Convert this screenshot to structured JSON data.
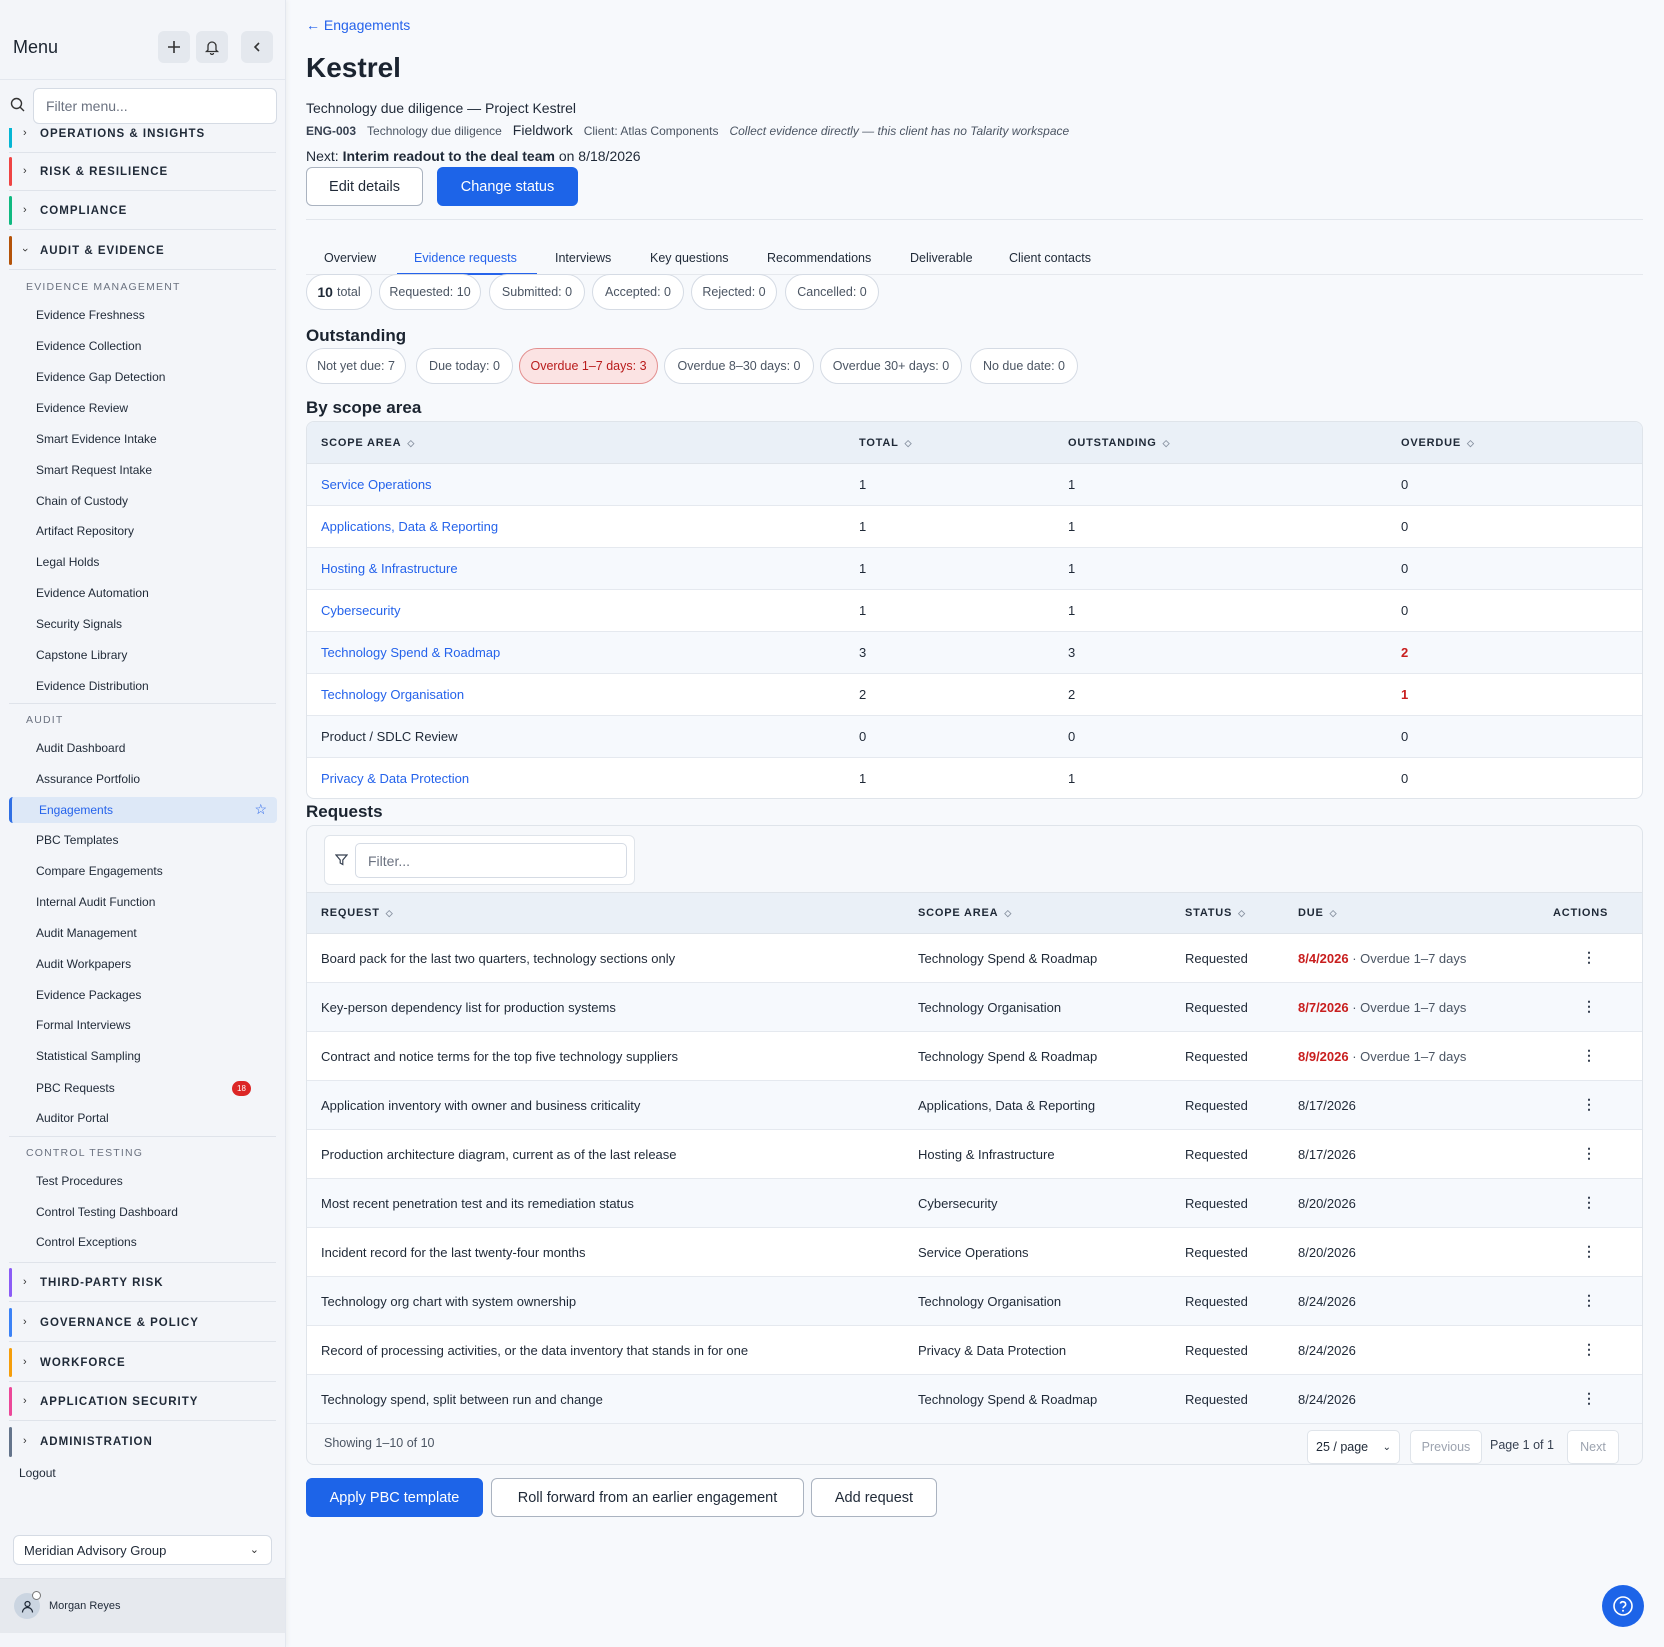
{
  "sidebar": {
    "title": "Menu",
    "filter_placeholder": "Filter menu...",
    "categories": [
      {
        "label": "OPERATIONS & INSIGHTS",
        "color": "#06b6d4"
      },
      {
        "label": "RISK & RESILIENCE",
        "color": "#ef4444"
      },
      {
        "label": "COMPLIANCE",
        "color": "#10b981"
      },
      {
        "label": "AUDIT & EVIDENCE",
        "color": "#b45309"
      },
      {
        "label": "THIRD-PARTY RISK",
        "color": "#8b5cf6"
      },
      {
        "label": "GOVERNANCE & POLICY",
        "color": "#3b82f6"
      },
      {
        "label": "WORKFORCE",
        "color": "#f59e0b"
      },
      {
        "label": "APPLICATION SECURITY",
        "color": "#ec4899"
      },
      {
        "label": "ADMINISTRATION",
        "color": "#64748b"
      }
    ],
    "sections": {
      "evidence": "EVIDENCE MANAGEMENT",
      "audit": "AUDIT",
      "control": "CONTROL TESTING"
    },
    "evidence_items": [
      "Evidence Freshness",
      "Evidence Collection",
      "Evidence Gap Detection",
      "Evidence Review",
      "Smart Evidence Intake",
      "Smart Request Intake",
      "Chain of Custody",
      "Artifact Repository",
      "Legal Holds",
      "Evidence Automation",
      "Security Signals",
      "Capstone Library",
      "Evidence Distribution"
    ],
    "audit_items": [
      "Audit Dashboard",
      "Assurance Portfolio",
      "Engagements",
      "PBC Templates",
      "Compare Engagements",
      "Internal Audit Function",
      "Audit Management",
      "Audit Workpapers",
      "Evidence Packages",
      "Formal Interviews",
      "Statistical Sampling",
      "PBC Requests",
      "Auditor Portal"
    ],
    "pbc_badge": "18",
    "control_items": [
      "Test Procedures",
      "Control Testing Dashboard",
      "Control Exceptions"
    ],
    "logout": "Logout",
    "org": "Meridian Advisory Group",
    "user": "Morgan Reyes"
  },
  "header": {
    "back": "← Engagements",
    "title": "Kestrel",
    "subtitle": "Technology due diligence — Project Kestrel",
    "code": "ENG-003",
    "type": "Technology due diligence",
    "phase": "Fieldwork",
    "client": "Client: Atlas Components",
    "note": "Collect evidence directly — this client has no Talarity workspace",
    "next_prefix": "Next: ",
    "next_item": "Interim readout to the deal team",
    "next_suffix": " on 8/18/2026",
    "edit": "Edit details",
    "change": "Change status"
  },
  "tabs": [
    "Overview",
    "Evidence requests",
    "Interviews",
    "Key questions",
    "Recommendations",
    "Deliverable",
    "Client contacts"
  ],
  "status_chips": {
    "total_num": "10",
    "total_word": "total",
    "items": [
      "Requested: 10",
      "Submitted: 0",
      "Accepted: 0",
      "Rejected: 0",
      "Cancelled: 0"
    ]
  },
  "outstanding": {
    "title": "Outstanding",
    "chips": [
      "Not yet due: 7",
      "Due today: 0",
      "Overdue 1–7 days: 3",
      "Overdue 8–30 days: 0",
      "Overdue 30+ days: 0",
      "No due date: 0"
    ]
  },
  "scope": {
    "title": "By scope area",
    "headers": [
      "SCOPE AREA",
      "TOTAL",
      "OUTSTANDING",
      "OVERDUE"
    ],
    "rows": [
      {
        "area": "Service Operations",
        "total": "1",
        "outstanding": "1",
        "overdue": "0"
      },
      {
        "area": "Applications, Data & Reporting",
        "total": "1",
        "outstanding": "1",
        "overdue": "0"
      },
      {
        "area": "Hosting & Infrastructure",
        "total": "1",
        "outstanding": "1",
        "overdue": "0"
      },
      {
        "area": "Cybersecurity",
        "total": "1",
        "outstanding": "1",
        "overdue": "0"
      },
      {
        "area": "Technology Spend & Roadmap",
        "total": "3",
        "outstanding": "3",
        "overdue": "2"
      },
      {
        "area": "Technology Organisation",
        "total": "2",
        "outstanding": "2",
        "overdue": "1"
      },
      {
        "area": "Product / SDLC Review",
        "total": "0",
        "outstanding": "0",
        "overdue": "0"
      },
      {
        "area": "Privacy & Data Protection",
        "total": "1",
        "outstanding": "1",
        "overdue": "0"
      }
    ]
  },
  "requests": {
    "title": "Requests",
    "filter_placeholder": "Filter...",
    "headers": [
      "REQUEST",
      "SCOPE AREA",
      "STATUS",
      "DUE",
      "ACTIONS"
    ],
    "rows": [
      {
        "request": "Board pack for the last two quarters, technology sections only",
        "area": "Technology Spend & Roadmap",
        "status": "Requested",
        "due": "8/4/2026",
        "tag": " · Overdue 1–7 days"
      },
      {
        "request": "Key-person dependency list for production systems",
        "area": "Technology Organisation",
        "status": "Requested",
        "due": "8/7/2026",
        "tag": " · Overdue 1–7 days"
      },
      {
        "request": "Contract and notice terms for the top five technology suppliers",
        "area": "Technology Spend & Roadmap",
        "status": "Requested",
        "due": "8/9/2026",
        "tag": " · Overdue 1–7 days"
      },
      {
        "request": "Application inventory with owner and business criticality",
        "area": "Applications, Data & Reporting",
        "status": "Requested",
        "due": "8/17/2026",
        "tag": ""
      },
      {
        "request": "Production architecture diagram, current as of the last release",
        "area": "Hosting & Infrastructure",
        "status": "Requested",
        "due": "8/17/2026",
        "tag": ""
      },
      {
        "request": "Most recent penetration test and its remediation status",
        "area": "Cybersecurity",
        "status": "Requested",
        "due": "8/20/2026",
        "tag": ""
      },
      {
        "request": "Incident record for the last twenty-four months",
        "area": "Service Operations",
        "status": "Requested",
        "due": "8/20/2026",
        "tag": ""
      },
      {
        "request": "Technology org chart with system ownership",
        "area": "Technology Organisation",
        "status": "Requested",
        "due": "8/24/2026",
        "tag": ""
      },
      {
        "request": "Record of processing activities, or the data inventory that stands in for one",
        "area": "Privacy & Data Protection",
        "status": "Requested",
        "due": "8/24/2026",
        "tag": ""
      },
      {
        "request": "Technology spend, split between run and change",
        "area": "Technology Spend & Roadmap",
        "status": "Requested",
        "due": "8/24/2026",
        "tag": ""
      }
    ],
    "showing": "Showing 1–10 of 10",
    "per_page": "25 / page",
    "previous": "Previous",
    "page": "Page 1 of 1",
    "next": "Next"
  },
  "actions": {
    "apply": "Apply PBC template",
    "roll": "Roll forward from an earlier engagement",
    "add": "Add request"
  }
}
